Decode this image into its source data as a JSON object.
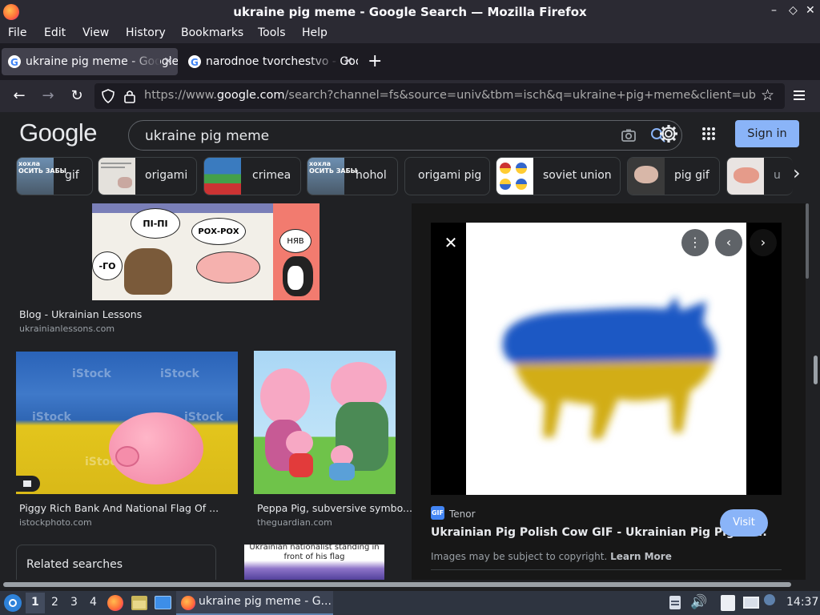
{
  "window": {
    "title": "ukraine pig meme - Google Search — Mozilla Firefox",
    "controls": [
      "–",
      "◇",
      "✕"
    ]
  },
  "menu": [
    "File",
    "Edit",
    "View",
    "History",
    "Bookmarks",
    "Tools",
    "Help"
  ],
  "tabs": [
    {
      "label": "ukraine pig meme - Google Search",
      "active": true
    },
    {
      "label": "narodnoe tvorchestvo - Google Search",
      "active": false
    }
  ],
  "url": {
    "prefix": "https://www.",
    "domain": "google.com",
    "path": "/search?channel=fs&source=univ&tbm=isch&q=ukraine+pig+meme&client=ubuntu"
  },
  "google": {
    "logo": "Google",
    "query": "ukraine pig meme",
    "signin": "Sign in"
  },
  "chips": [
    "gif",
    "origami",
    "crimea",
    "hohol",
    "origami pig",
    "soviet union",
    "pig gif",
    "u"
  ],
  "chip_thumb_texts": {
    "gif": "хохла\nОСИТЬ ЗАБЫ",
    "hohol": "хохла\nОСИТЬ ЗАБЫ"
  },
  "results": {
    "top": {
      "caption": "Blog - Ukrainian Lessons",
      "source": "ukrainianlessons.com",
      "bubbles": [
        "ПІ-ПІ",
        "РОХ-РОХ",
        "НЯВ",
        "-ГО"
      ]
    },
    "left": {
      "caption": "Piggy Rich Bank And National Flag Of ...",
      "source": "istockphoto.com",
      "watermark": "iStock"
    },
    "right": {
      "caption": "Peppa Pig, subversive symbo...",
      "source": "theguardian.com"
    },
    "related": "Related searches",
    "partial_caption": "Ukrainian nationalist standing in front of his flag"
  },
  "preview": {
    "source": "Tenor",
    "source_badge": "GIF",
    "title": "Ukrainian Pig Polish Cow GIF - Ukrainian Pig Pig Po...",
    "visit": "Visit",
    "copyright": "Images may be subject to copyright.",
    "learn_more": "Learn More"
  },
  "taskbar": {
    "workspaces": [
      "1",
      "2",
      "3",
      "4"
    ],
    "window_label": "ukraine pig meme - G...",
    "time": "14:37"
  },
  "colors": {
    "accent": "#8ab4f8",
    "bg": "#202124",
    "flag_blue": "#1d5fbf",
    "flag_yellow": "#e6c400"
  }
}
